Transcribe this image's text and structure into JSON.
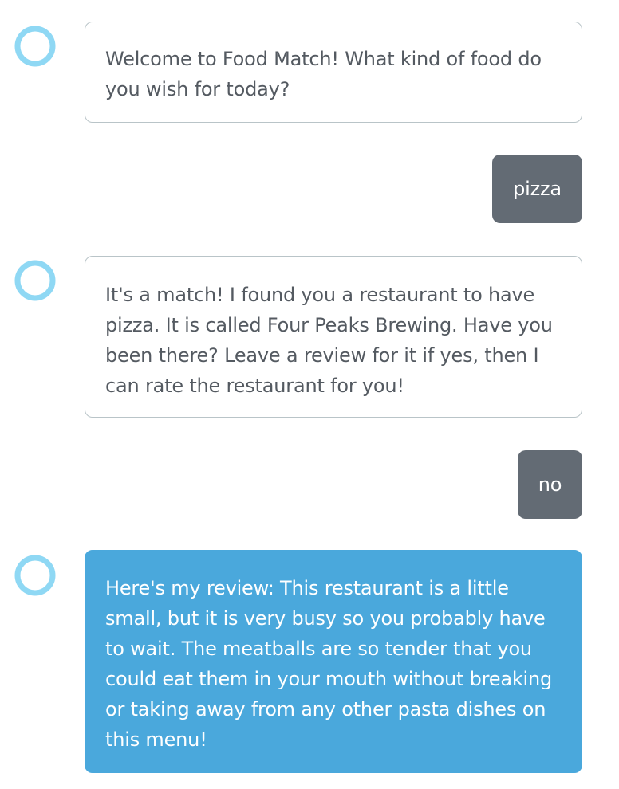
{
  "colors": {
    "assistant_bubble_border": "#b9c4c8",
    "assistant_text": "#545a61",
    "user_bubble": "#636b74",
    "highlight_bubble": "#4aa8dc",
    "avatar_ring": "#8fd8f4"
  },
  "avatar_icon": "alexa-ring-icon",
  "messages": [
    {
      "role": "assistant",
      "text": "Welcome to Food Match! What kind of food do you wish for today?"
    },
    {
      "role": "user",
      "text": "pizza"
    },
    {
      "role": "assistant",
      "text": "It's a match! I found you a restaurant to have pizza. It is called Four Peaks Brewing. Have you been there? Leave a review for it if yes, then I can rate the restaurant for you!"
    },
    {
      "role": "user",
      "text": "no"
    },
    {
      "role": "assistant",
      "highlighted": true,
      "text": "Here's my review: This restaurant is a little small, but it is very busy so you probably have to wait. The meatballs are so tender that you could eat them in your mouth without breaking or taking away from any other pasta dishes on this menu!"
    }
  ]
}
